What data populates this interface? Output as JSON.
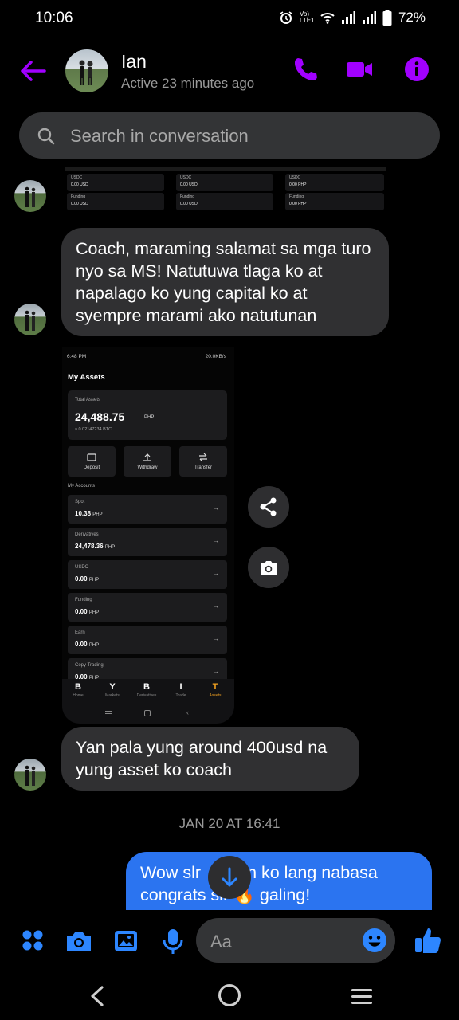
{
  "status_bar": {
    "time": "10:06",
    "network": "Vo) LTE1",
    "battery": "72%"
  },
  "header": {
    "contact_name": "Ian",
    "contact_status": "Active 23 minutes ago",
    "accent_color": "#a100ff"
  },
  "search": {
    "placeholder": "Search in conversation"
  },
  "top_image_cards": [
    {
      "name": "USDC",
      "value": "0.00",
      "unit": "USD"
    },
    {
      "name": "USDC",
      "value": "0.00",
      "unit": "USD"
    },
    {
      "name": "USDC",
      "value": "0.00",
      "unit": "PHP"
    },
    {
      "name": "Funding",
      "value": "0.00",
      "unit": "USD"
    },
    {
      "name": "Funding",
      "value": "0.00",
      "unit": "USD"
    },
    {
      "name": "Funding",
      "value": "0.00",
      "unit": "PHP"
    }
  ],
  "messages": {
    "m1": "Coach, maraming salamat sa mga turo nyo sa MS! Natutuwa tlaga ko at napalago ko yung capital ko at syempre marami ako natutunan",
    "m2": "Yan pala yung around 400usd na yung asset ko coach",
    "m3_line1": "Wow slr",
    "m3_line1b": "n ko lang nabasa",
    "m3_line2a": "congrats sir",
    "m3_line2b": "galing!",
    "m3_emoji": "🔥"
  },
  "timestamp": "JAN 20 AT 16:41",
  "shared_screenshot": {
    "status_left": "6:48 PM",
    "status_right": "20.0KB/s",
    "title": "My Assets",
    "total_label": "Total Assets",
    "total_value": "24,488.75",
    "total_currency": "PHP",
    "total_btc": "≈ 0.02147234 BTC",
    "actions": [
      "Deposit",
      "Withdraw",
      "Transfer"
    ],
    "accounts_header": "My Accounts",
    "accounts": [
      {
        "name": "Spot",
        "value": "10.38",
        "cur": "PHP"
      },
      {
        "name": "Derivatives",
        "value": "24,478.36",
        "cur": "PHP"
      },
      {
        "name": "USDC",
        "value": "0.00",
        "cur": "PHP"
      },
      {
        "name": "Funding",
        "value": "0.00",
        "cur": "PHP"
      },
      {
        "name": "Earn",
        "value": "0.00",
        "cur": "PHP"
      },
      {
        "name": "Copy Trading",
        "value": "0.00",
        "cur": "PHP"
      }
    ],
    "nav": [
      {
        "glyph": "B",
        "label": "Home"
      },
      {
        "glyph": "Y",
        "label": "Markets"
      },
      {
        "glyph": "B",
        "label": "Derivatives"
      },
      {
        "glyph": "I",
        "label": "Trade"
      },
      {
        "glyph": "T",
        "label": "Assets"
      }
    ]
  },
  "composer": {
    "placeholder": "Aa",
    "blue": "#2d86ff"
  }
}
